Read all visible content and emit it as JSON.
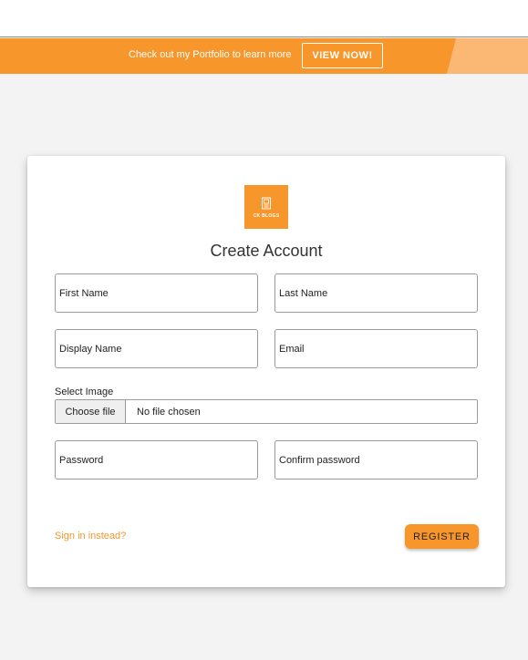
{
  "promo": {
    "text": "Check out my Portfolio to learn more",
    "button_label": "VIEW NOW!"
  },
  "logo": {
    "text": "CK BLOGS",
    "icon": "document-icon"
  },
  "form": {
    "title": "Create Account",
    "fields": {
      "first_name": "First Name",
      "last_name": "Last Name",
      "display_name": "Display Name",
      "email": "Email",
      "password": "Password",
      "confirm_password": "Confirm password"
    },
    "select_image_label": "Select Image",
    "file_button_label": "Choose file",
    "file_status": "No file chosen",
    "signin_link": "Sign in instead?",
    "register_label": "REGISTER"
  },
  "colors": {
    "accent": "#f7962a",
    "accent_light": "#fbb875",
    "background": "#f3f3f3"
  }
}
